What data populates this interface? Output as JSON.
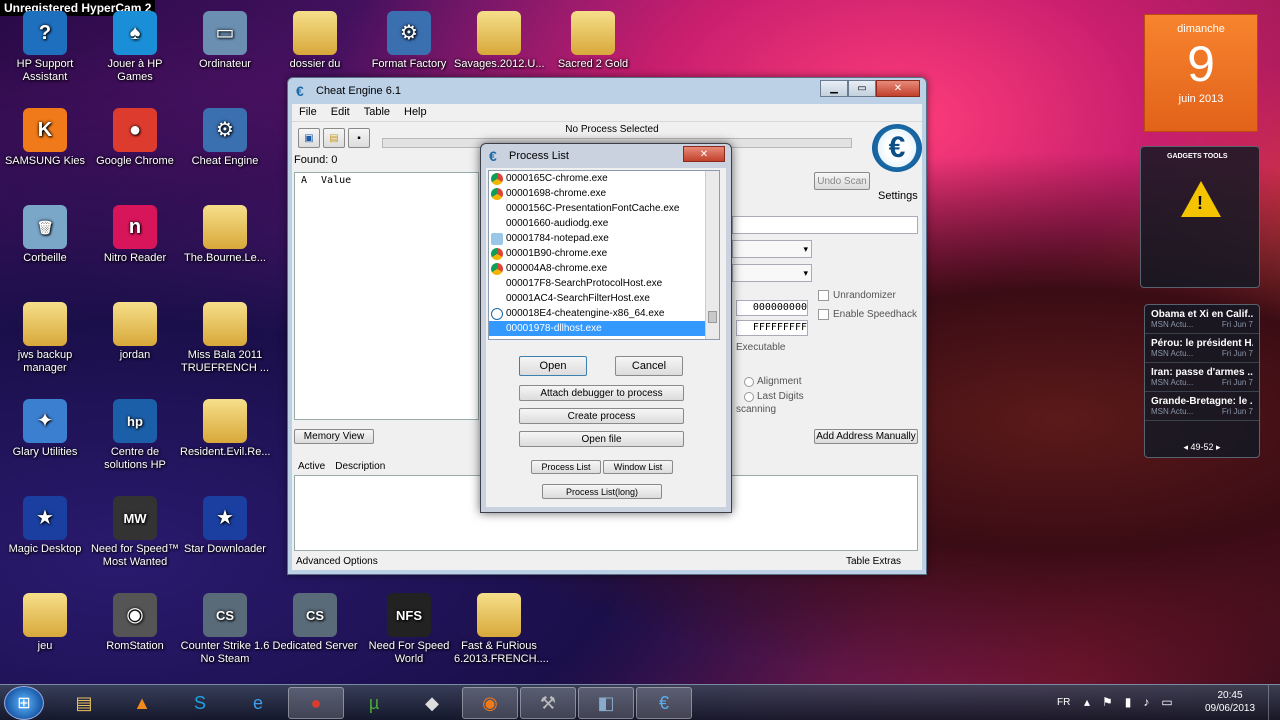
{
  "watermark": "Unregistered HyperCam 2",
  "desktop_icons": [
    {
      "label": "HP Support Assistant",
      "glyph": "?"
    },
    {
      "label": "Jouer à HP Games",
      "glyph": "♠"
    },
    {
      "label": "Ordinateur",
      "glyph": "▭"
    },
    {
      "label": "dossier du",
      "glyph": ""
    },
    {
      "label": "Format Factory",
      "glyph": "⚙"
    },
    {
      "label": "Savages.2012.U...",
      "glyph": ""
    },
    {
      "label": "Sacred 2 Gold",
      "glyph": ""
    },
    {
      "label": "SAMSUNG Kies",
      "glyph": "K"
    },
    {
      "label": "Google Chrome",
      "glyph": "●"
    },
    {
      "label": "Cheat Engine",
      "glyph": "⚙"
    },
    {
      "label": "Corbeille",
      "glyph": "🗑"
    },
    {
      "label": "Nitro Reader",
      "glyph": "n"
    },
    {
      "label": "The.Bourne.Le...",
      "glyph": ""
    },
    {
      "label": "jws backup manager",
      "glyph": ""
    },
    {
      "label": "jordan",
      "glyph": ""
    },
    {
      "label": "Miss Bala 2011 TRUEFRENCH ...",
      "glyph": ""
    },
    {
      "label": "Glary Utilities",
      "glyph": "✦"
    },
    {
      "label": "Centre de solutions HP",
      "glyph": "hp"
    },
    {
      "label": "Resident.Evil.Re...",
      "glyph": ""
    },
    {
      "label": "Magic Desktop",
      "glyph": "★"
    },
    {
      "label": "Need for Speed™ Most Wanted",
      "glyph": "MW"
    },
    {
      "label": "Star Downloader",
      "glyph": "★"
    },
    {
      "label": "jeu",
      "glyph": ""
    },
    {
      "label": "RomStation",
      "glyph": "◉"
    },
    {
      "label": "Counter Strike 1.6 No Steam",
      "glyph": "CS"
    },
    {
      "label": "Dedicated Server",
      "glyph": "CS"
    },
    {
      "label": "Need For Speed World",
      "glyph": "NFS"
    },
    {
      "label": "Fast & FuRious 6.2013.FRENCH....",
      "glyph": ""
    }
  ],
  "calendar": {
    "weekday": "dimanche",
    "day": "9",
    "month": "juin 2013"
  },
  "alert_gadget": {
    "header": "GADGETS TOOLS",
    "icon": "warning-icon"
  },
  "news_gadget": {
    "items": [
      {
        "title": "Obama et Xi en Calif...",
        "source": "MSN Actu...",
        "date": "Fri Jun 7"
      },
      {
        "title": "Pérou: le président H...",
        "source": "MSN Actu...",
        "date": "Fri Jun 7"
      },
      {
        "title": "Iran: passe d'armes ...",
        "source": "MSN Actu...",
        "date": "Fri Jun 7"
      },
      {
        "title": "Grande-Bretagne: le ...",
        "source": "MSN Actu...",
        "date": "Fri Jun 7"
      }
    ],
    "pager": "49-52"
  },
  "cheat_engine": {
    "title": "Cheat Engine 6.1",
    "menu": [
      "File",
      "Edit",
      "Table",
      "Help"
    ],
    "status": "No Process Selected",
    "found": "Found: 0",
    "col_a": "A",
    "col_value": "Value",
    "undo_scan": "Undo Scan",
    "settings": "Settings",
    "hex1": "000000000",
    "hex2": "FFFFFFFFF",
    "executable": "Executable",
    "unrandomizer": "Unrandomizer",
    "enable_speedhack": "Enable Speedhack",
    "alignment": "Alignment",
    "last_digits": "Last Digits",
    "scanning": "scanning",
    "memory_view": "Memory View",
    "add_address": "Add Address Manually",
    "col_active": "Active",
    "col_description": "Description",
    "advanced_options": "Advanced Options",
    "table_extras": "Table Extras"
  },
  "process_dialog": {
    "title": "Process List",
    "processes": [
      {
        "name": "0000165C-chrome.exe",
        "icon": "chrome",
        "selected": false
      },
      {
        "name": "00001698-chrome.exe",
        "icon": "chrome",
        "selected": false
      },
      {
        "name": "0000156C-PresentationFontCache.exe",
        "icon": "",
        "selected": false
      },
      {
        "name": "00001660-audiodg.exe",
        "icon": "",
        "selected": false
      },
      {
        "name": "00001784-notepad.exe",
        "icon": "notepad",
        "selected": false
      },
      {
        "name": "00001B90-chrome.exe",
        "icon": "chrome",
        "selected": false
      },
      {
        "name": "000004A8-chrome.exe",
        "icon": "chrome",
        "selected": false
      },
      {
        "name": "000017F8-SearchProtocolHost.exe",
        "icon": "",
        "selected": false
      },
      {
        "name": "00001AC4-SearchFilterHost.exe",
        "icon": "",
        "selected": false
      },
      {
        "name": "000018E4-cheatengine-x86_64.exe",
        "icon": "cheatengine",
        "selected": false
      },
      {
        "name": "00001978-dllhost.exe",
        "icon": "",
        "selected": true
      }
    ],
    "open": "Open",
    "cancel": "Cancel",
    "attach_debugger": "Attach debugger to process",
    "create_process": "Create process",
    "open_file": "Open file",
    "process_list": "Process List",
    "window_list": "Window List",
    "process_list_long": "Process List(long)"
  },
  "taskbar": {
    "lang": "FR",
    "time": "20:45",
    "date": "09/06/2013",
    "apps": [
      "explorer",
      "vlc",
      "skype",
      "internet-explorer",
      "chrome",
      "utorrent",
      "unity",
      "blender",
      "cheat-engine-tool",
      "paint",
      "cheat-engine"
    ]
  }
}
